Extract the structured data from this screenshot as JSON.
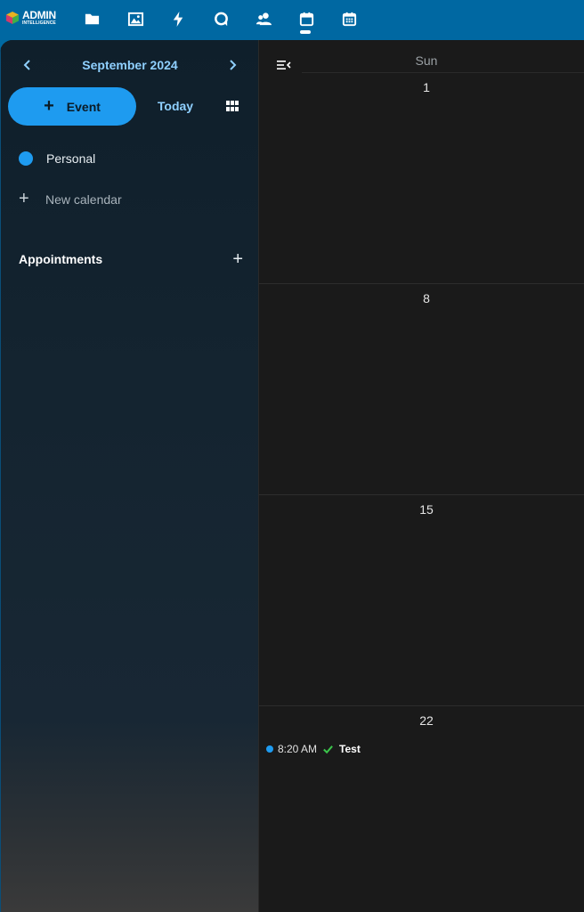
{
  "topbar": {
    "logo": {
      "line1": "ADMIN",
      "line2": "INTELLIGENCE"
    },
    "apps": [
      {
        "name": "files-icon"
      },
      {
        "name": "photos-icon"
      },
      {
        "name": "activity-icon"
      },
      {
        "name": "talk-icon"
      },
      {
        "name": "contacts-icon"
      },
      {
        "name": "calendar-icon",
        "active": true
      },
      {
        "name": "calendar-grid-icon"
      }
    ],
    "accent": "#0068a2"
  },
  "sidebar": {
    "month": "September 2024",
    "event_button": "Event",
    "today_button": "Today",
    "calendars": [
      {
        "label": "Personal",
        "color": "#1e9bf0"
      }
    ],
    "new_calendar": "New calendar",
    "appointments": "Appointments"
  },
  "week_view": {
    "day_header": "Sun",
    "weeks": [
      {
        "day": "1",
        "events": []
      },
      {
        "day": "8",
        "events": []
      },
      {
        "day": "15",
        "events": []
      },
      {
        "day": "22",
        "events": [
          {
            "time": "8:20 AM",
            "title": "Test",
            "status": "confirmed"
          }
        ]
      }
    ]
  }
}
